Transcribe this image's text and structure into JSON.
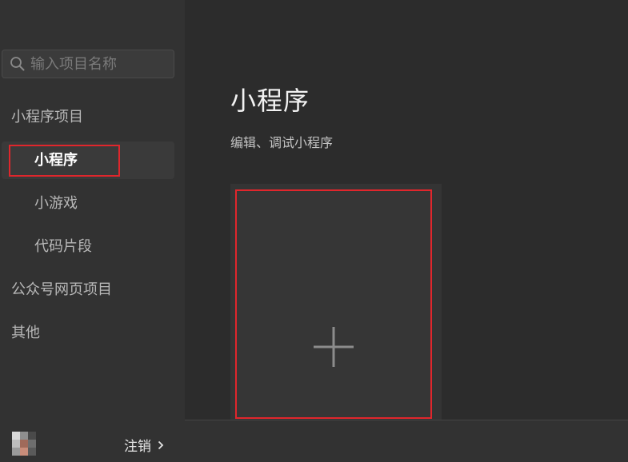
{
  "search": {
    "placeholder": "输入项目名称",
    "icon": "search-icon"
  },
  "sidebar": {
    "groups": [
      {
        "label": "小程序项目"
      },
      {
        "label": "公众号网页项目"
      },
      {
        "label": "其他"
      }
    ],
    "sub_items": [
      {
        "label": "小程序",
        "active": true
      },
      {
        "label": "小游戏",
        "active": false
      },
      {
        "label": "代码片段",
        "active": false
      }
    ],
    "footer": {
      "logout_label": "注销",
      "chevron_icon": "chevron-right-icon",
      "avatar_icon": "avatar"
    }
  },
  "main": {
    "title": "小程序",
    "subtitle": "编辑、调试小程序",
    "new_card_icon": "plus-icon"
  },
  "colors": {
    "background": "#2c2c2c",
    "sidebar": "#323232",
    "highlight": "#e0262c",
    "active_text": "#ffffff",
    "text": "#b8b8b8"
  }
}
